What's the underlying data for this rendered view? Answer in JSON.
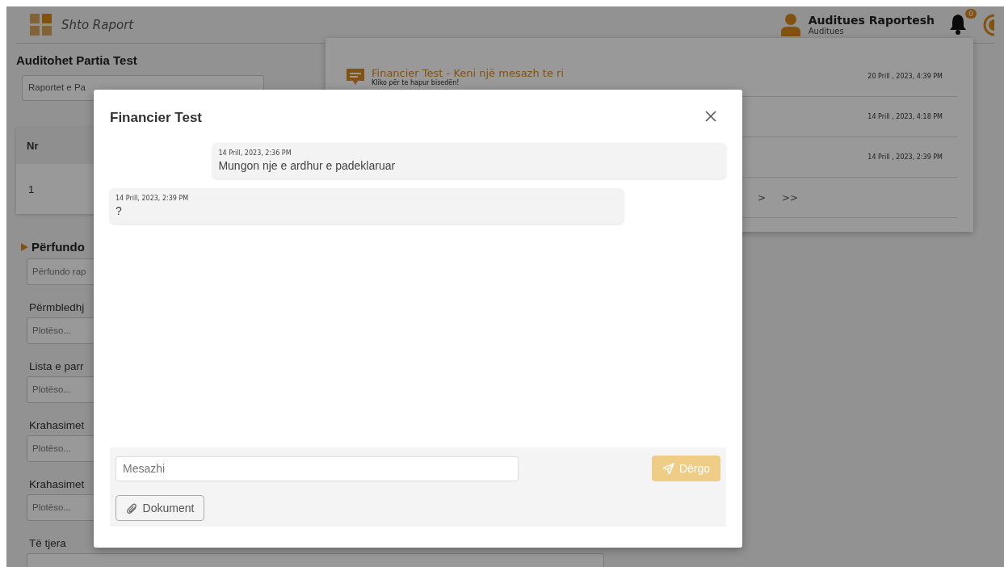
{
  "header": {
    "app_title": "Shto Raport",
    "user_name": "Auditues Raportesh",
    "user_role": "Auditues",
    "notification_count": "0"
  },
  "page": {
    "title": "Auditohet Partia Test",
    "report_select": "Raportet e Pa",
    "table": {
      "columns": [
        "Nr"
      ],
      "rows": [
        [
          "1"
        ]
      ]
    },
    "section": {
      "title": "Përfundo",
      "select": "Përfundo rap",
      "fields": [
        {
          "label": "Përmbledhj",
          "placeholder": "Plotëso..."
        },
        {
          "label": "Lista e parr",
          "placeholder": "Plotëso..."
        },
        {
          "label": "Krahasimet",
          "placeholder": "Plotëso..."
        },
        {
          "label": "Krahasimet",
          "placeholder": "Plotëso..."
        },
        {
          "label": "Të tjera"
        }
      ]
    }
  },
  "notifications": {
    "items": [
      {
        "title": "Financier Test - Keni një mesazh te ri",
        "subtitle": "Kliko për te hapur bisedën!",
        "date": "20 Prill , 2023, 4:39 PM"
      },
      {
        "date": "14 Prill , 2023, 4:18 PM"
      },
      {
        "date": "14 Prill , 2023, 2:39 PM"
      }
    ],
    "pagination": [
      ">",
      ">>"
    ]
  },
  "dialog": {
    "title": "Financier Test",
    "messages": [
      {
        "time": "14 Prill, 2023, 2:36 PM",
        "text": "Mungon nje e ardhur e padeklaruar",
        "outgoing": true
      },
      {
        "time": "14 Prill, 2023, 2:39 PM",
        "text": "?",
        "outgoing": false
      }
    ],
    "message_placeholder": "Mesazhi",
    "send": {
      "label": "Dërgo",
      "disabled": true
    },
    "attach_label": "Dokument"
  }
}
